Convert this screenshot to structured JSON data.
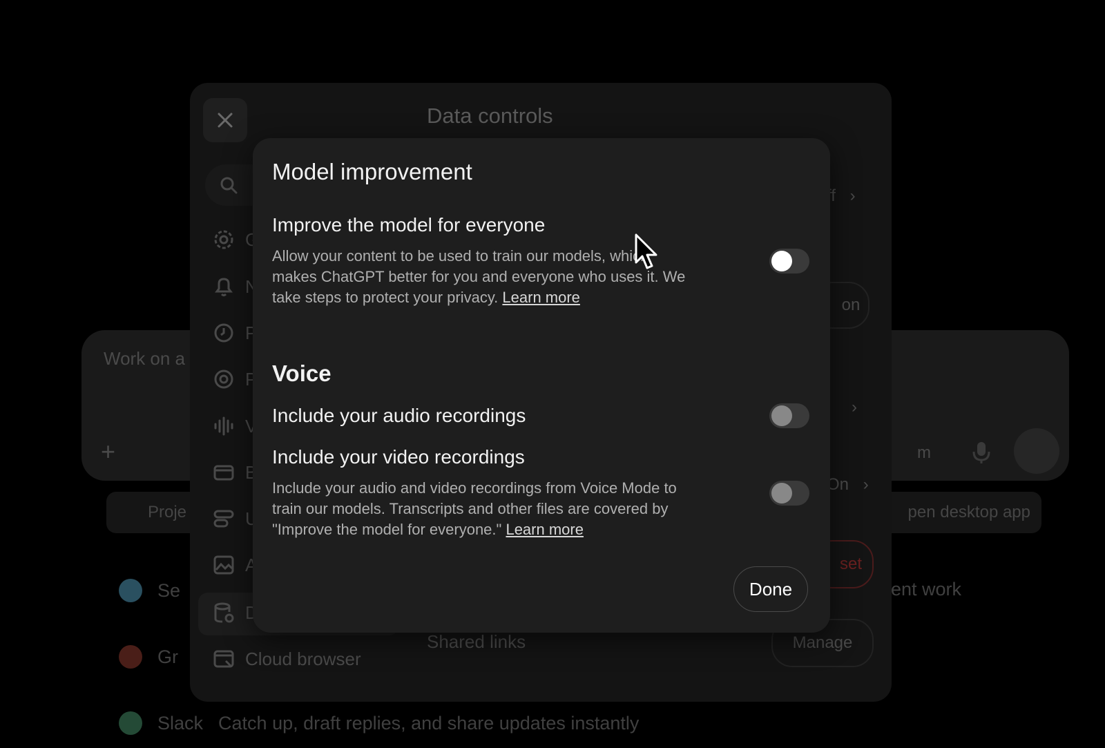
{
  "background": {
    "composer_placeholder": "Work on a",
    "model_selector": "m",
    "chips": [
      "Proje",
      "pen desktop app"
    ],
    "list": [
      {
        "label": "Se",
        "tail": "ent work",
        "color": "#3a8fb0"
      },
      {
        "label": "Gr",
        "color": "#b03a2a"
      },
      {
        "label": "Slack",
        "desc": "Catch up, draft replies, and share updates instantly",
        "color": "#3f9a6a"
      }
    ]
  },
  "settings": {
    "title": "Data controls",
    "nav_items": [
      {
        "label": "G",
        "icon": "gear-icon"
      },
      {
        "label": "N",
        "icon": "bell-icon"
      },
      {
        "label": "P",
        "icon": "clock-icon"
      },
      {
        "label": "P",
        "icon": "at-icon"
      },
      {
        "label": "V",
        "icon": "waveform-icon"
      },
      {
        "label": "B",
        "icon": "card-icon"
      },
      {
        "label": "U",
        "icon": "usage-icon"
      },
      {
        "label": "A",
        "icon": "image-icon"
      },
      {
        "label": "D",
        "icon": "database-icon"
      },
      {
        "label": "Cloud browser",
        "icon": "browser-icon"
      }
    ],
    "rows": {
      "row1_value": "ff",
      "row2_button": "on",
      "row4_value": "On",
      "reset_button": "set",
      "shared_links": "Shared links",
      "manage_button": "Manage"
    }
  },
  "modal": {
    "title": "Model improvement",
    "improve": {
      "title": "Improve the model for everyone",
      "desc_before": "Allow your content to be used to train our models, which makes ChatGPT better for you and everyone who uses it. We take steps to protect your privacy. ",
      "link": "Learn more",
      "enabled": false
    },
    "voice": {
      "heading": "Voice",
      "audio_title": "Include your audio recordings",
      "audio_enabled": false,
      "video_title": "Include your video recordings",
      "video_desc_before": "Include your audio and video recordings from Voice Mode to train our models. Transcripts and other files are covered by \"Improve the model for everyone.\" ",
      "video_link": "Learn more",
      "video_enabled": false
    },
    "done_label": "Done"
  }
}
